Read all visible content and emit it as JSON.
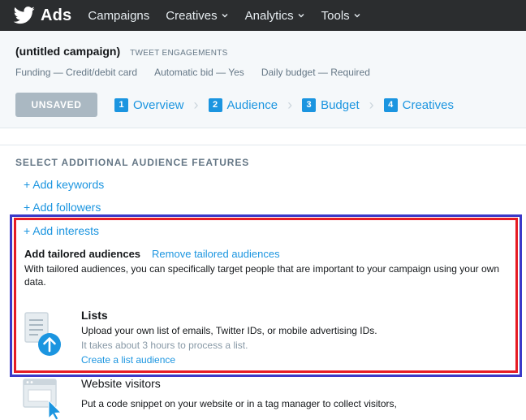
{
  "nav": {
    "brand": "Ads",
    "items": [
      {
        "label": "Campaigns",
        "caret": false
      },
      {
        "label": "Creatives",
        "caret": true
      },
      {
        "label": "Analytics",
        "caret": true
      },
      {
        "label": "Tools",
        "caret": true
      }
    ]
  },
  "campaign": {
    "title": "(untitled campaign)",
    "type": "TWEET ENGAGEMENTS",
    "meta": [
      "Funding — Credit/debit card",
      "Automatic bid — Yes",
      "Daily budget — Required"
    ],
    "status": "UNSAVED",
    "steps": [
      {
        "num": "1",
        "label": "Overview"
      },
      {
        "num": "2",
        "label": "Audience"
      },
      {
        "num": "3",
        "label": "Budget"
      },
      {
        "num": "4",
        "label": "Creatives"
      }
    ]
  },
  "audience": {
    "section_heading": "SELECT ADDITIONAL AUDIENCE FEATURES",
    "add_keywords": "+ Add keywords",
    "add_followers": "+ Add followers",
    "add_interests": "+ Add interests",
    "tailored_title": "Add tailored audiences",
    "tailored_remove": "Remove tailored audiences",
    "tailored_desc": "With tailored audiences, you can specifically target people that are important to your campaign using your own data.",
    "lists": {
      "title": "Lists",
      "desc": "Upload your own list of emails, Twitter IDs, or mobile advertising IDs.",
      "note": "It takes about 3 hours to process a list.",
      "link": "Create a list audience",
      "icon": "list-upload-icon"
    },
    "website": {
      "title": "Website visitors",
      "desc": "Put a code snippet on your website or in a tag manager to collect visitors,",
      "icon": "website-visitors-icon"
    }
  },
  "colors": {
    "nav_bg": "#2b2d2f",
    "accent": "#1b95e0",
    "highlight_outer": "#3b39c8",
    "highlight_inner": "#e61c24"
  }
}
